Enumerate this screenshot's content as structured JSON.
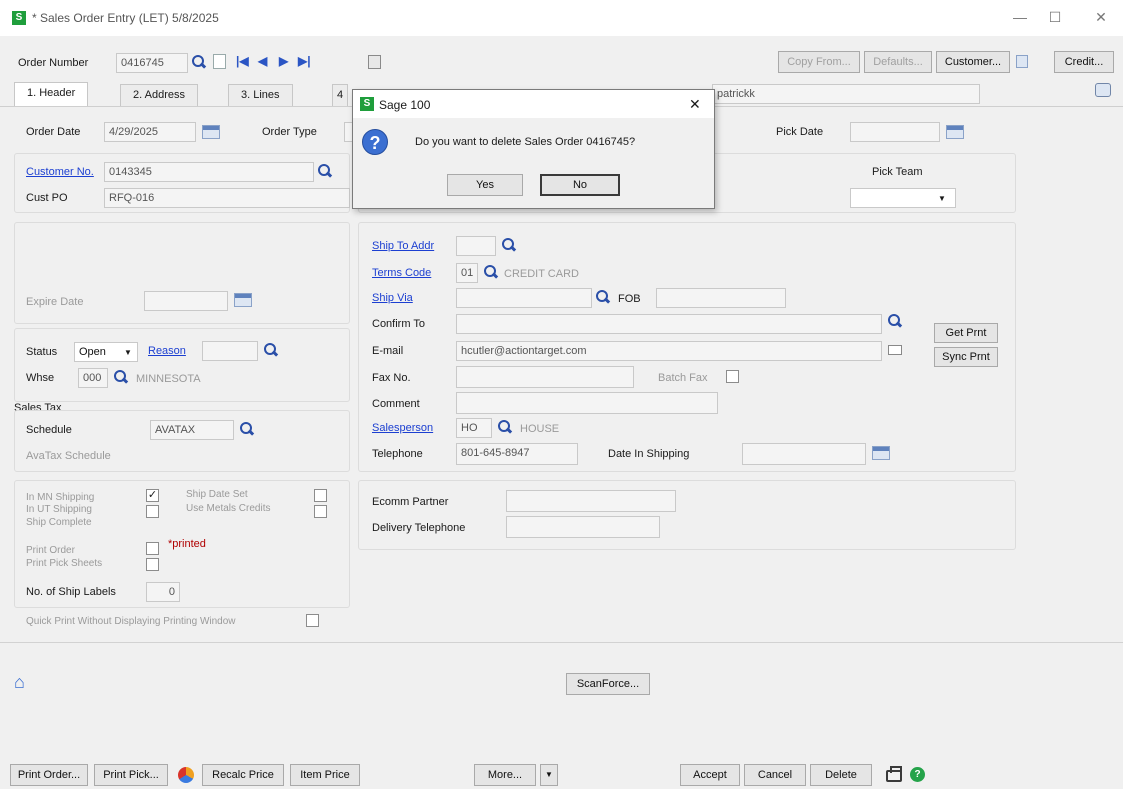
{
  "window": {
    "title": "* Sales Order Entry (LET) 5/8/2025",
    "app_icon": "S",
    "minimize_icon": "—",
    "maximize_icon": "☐",
    "close_icon": "✕"
  },
  "toolbar": {
    "order_number_label": "Order Number",
    "order_number_value": "0416745",
    "copy_from_label": "Copy From...",
    "defaults_label": "Defaults...",
    "customer_label": "Customer...",
    "credit_label": "Credit..."
  },
  "tabs": [
    {
      "label": "1. Header"
    },
    {
      "label": "2. Address"
    },
    {
      "label": "3. Lines"
    },
    {
      "label": "4"
    }
  ],
  "user_field": "patrickk",
  "header": {
    "order_date_label": "Order Date",
    "order_date_value": "4/29/2025",
    "order_type_label": "Order Type",
    "pick_date_label": "Pick Date",
    "pick_date_value": "",
    "customer_no_label": "Customer No.",
    "customer_no_value": "0143345",
    "cust_po_label": "Cust PO",
    "cust_po_value": "RFQ-016",
    "pick_team_label": "Pick Team",
    "pick_team_value": "",
    "expire_date_label": "Expire Date",
    "expire_date_value": ""
  },
  "status_panel": {
    "status_label": "Status",
    "status_value": "Open",
    "reason_label": "Reason",
    "whse_label": "Whse",
    "whse_code": "000",
    "whse_name": "MINNESOTA",
    "sales_tax_label": "Sales Tax",
    "schedule_label": "Schedule",
    "schedule_value": "AVATAX",
    "avatax_schedule_label": "AvaTax Schedule"
  },
  "ship_panel": {
    "ship_to_addr_label": "Ship To Addr",
    "terms_code_label": "Terms Code",
    "terms_code_value": "01",
    "terms_code_desc": "CREDIT CARD",
    "ship_via_label": "Ship Via",
    "fob_label": "FOB",
    "confirm_to_label": "Confirm To",
    "email_label": "E-mail",
    "email_value": "hcutler@actiontarget.com",
    "fax_no_label": "Fax No.",
    "batch_fax_label": "Batch Fax",
    "comment_label": "Comment",
    "salesperson_label": "Salesperson",
    "salesperson_code": "HO",
    "salesperson_name": "HOUSE",
    "telephone_label": "Telephone",
    "telephone_value": "801-645-8947",
    "date_in_shipping_label": "Date In Shipping",
    "get_prnt_label": "Get Prnt",
    "sync_prnt_label": "Sync Prnt"
  },
  "options_panel": {
    "in_mn_shipping_label": "In MN Shipping",
    "in_ut_shipping_label": "In UT Shipping",
    "ship_complete_label": "Ship Complete",
    "print_order_label": "Print Order",
    "print_pick_sheets_label": "Print Pick Sheets",
    "ship_date_set_label": "Ship Date Set",
    "use_metals_credits_label": "Use Metals Credits",
    "printed_note": "*printed",
    "no_of_ship_labels_label": "No. of Ship Labels",
    "no_of_ship_labels_value": "0",
    "quick_print_label": "Quick Print Without Displaying Printing Window",
    "check_mark": "✓"
  },
  "ecomm": {
    "ecomm_partner_label": "Ecomm Partner",
    "delivery_telephone_label": "Delivery Telephone"
  },
  "scanforce_label": "ScanForce...",
  "bottom": {
    "print_order_label": "Print Order...",
    "print_pick_label": "Print Pick...",
    "recalc_price_label": "Recalc Price",
    "item_price_label": "Item Price",
    "more_label": "More...",
    "accept_label": "Accept",
    "cancel_label": "Cancel",
    "delete_label": "Delete",
    "help_icon": "?"
  },
  "dialog": {
    "title": "Sage 100",
    "message": "Do you want to delete Sales Order 0416745?",
    "yes_label": "Yes",
    "no_label": "No",
    "close_icon": "✕",
    "question_icon": "?"
  },
  "colors": {
    "link": "#1c3fd1",
    "accent": "#3b6fd1",
    "brand": "#1f9e3c",
    "printed_note": "#b00000"
  }
}
